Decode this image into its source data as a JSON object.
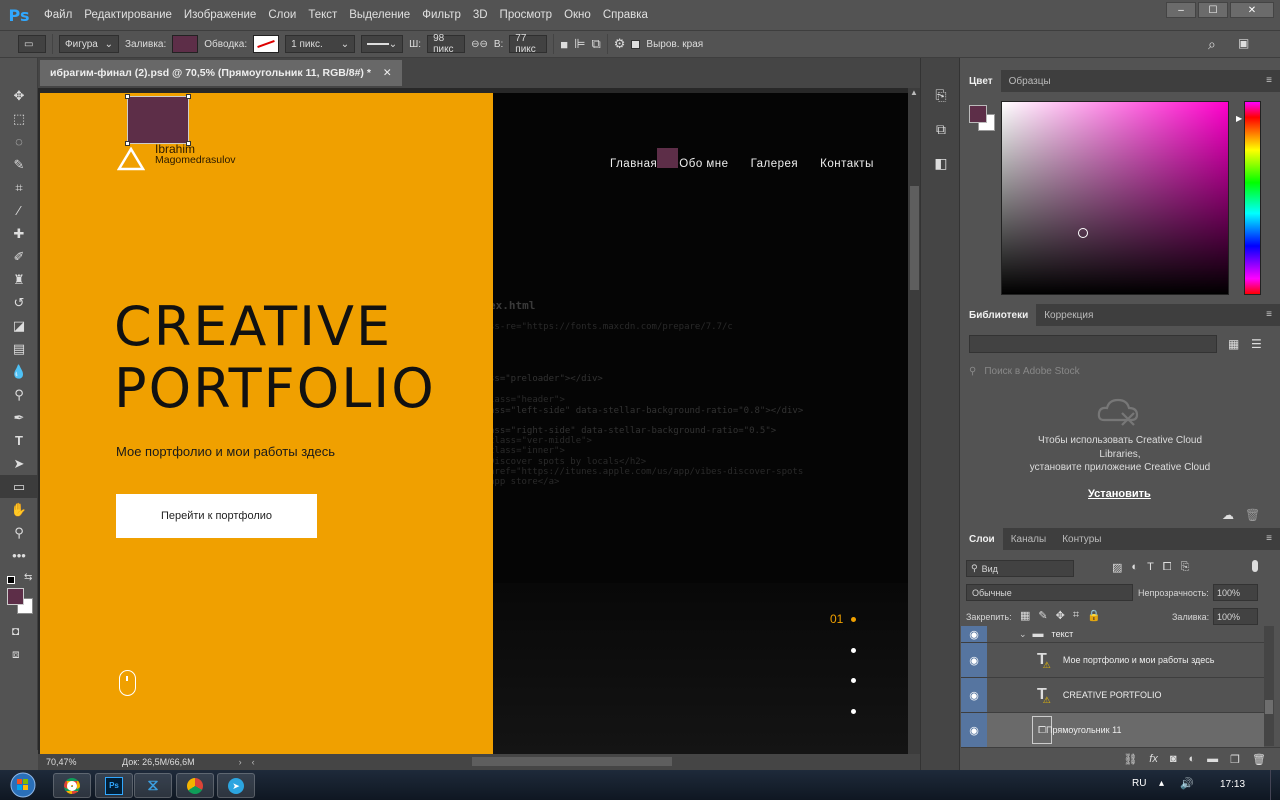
{
  "app": {
    "logo": "Ps"
  },
  "menu": [
    "Файл",
    "Редактирование",
    "Изображение",
    "Слои",
    "Текст",
    "Выделение",
    "Фильтр",
    "3D",
    "Просмотр",
    "Окно",
    "Справка"
  ],
  "options": {
    "tool_mode": "Фигура",
    "fill_label": "Заливка:",
    "stroke_label": "Обводка:",
    "stroke_size": "1 пикс.",
    "width_label": "Ш:",
    "width_value": "98 пикс",
    "height_label": "В:",
    "height_value": "77 пикс",
    "align_edges": "Выров. края",
    "fill_color": "#5d2e48"
  },
  "document": {
    "tab_title": "ибрагим-финал (2).psd @ 70,5% (Прямоугольник 11, RGB/8#) *",
    "zoom": "70,47%",
    "doc_size": "Док: 26,5M/66,6M"
  },
  "canvas": {
    "logo_first": "Ibrahim",
    "logo_last": "Magomedrasulov",
    "headline_1": "CREATIVE",
    "headline_2": "PORTFOLIO",
    "subline": "Мое портфолио и мои работы здесь",
    "cta": "Перейти к портфолио",
    "nav": [
      "Главная",
      "Обо мне",
      "Галерея",
      "Контакты"
    ],
    "slide_number": "01",
    "code_lines": [
      "ex.html",
      "ss-re=\"https://fonts.maxcdn.com/prepare/7.7/c",
      "ss=\"preloader\"></div>",
      "lass=\"header\">",
      "ass=\"left-side\" data-stellar-background-ratio=\"0.8\"></div>",
      "ass=\"right-side\" data-stellar-background-ratio=\"0.5\">",
      "class=\"ver-middle\">",
      "class=\"inner\">",
      "Discover spots by locals</h2>",
      "href=\"https://itunes.apple.com/us/app/vibes-discover-spots",
      "app store</a>"
    ],
    "accent": "#f0a000",
    "shape_color": "#5d2e48"
  },
  "color_panel": {
    "tabs": [
      "Цвет",
      "Образцы"
    ],
    "foreground": "#5d2e48",
    "background": "#ffffff"
  },
  "libraries_panel": {
    "tabs": [
      "Библиотеки",
      "Коррекция"
    ],
    "search_placeholder": "Поиск в Adobe Stock",
    "message_1": "Чтобы использовать Creative Cloud",
    "message_2": "Libraries,",
    "message_3": "установите приложение Creative Cloud",
    "install": "Установить"
  },
  "layers_panel": {
    "tabs": [
      "Слои",
      "Каналы",
      "Контуры"
    ],
    "filter": "Вид",
    "blend_mode": "Обычные",
    "opacity_label": "Непрозрачность:",
    "opacity_value": "100%",
    "lock_label": "Закрепить:",
    "fill_label": "Заливка:",
    "fill_value": "100%",
    "layers": [
      {
        "name": "текст",
        "kind": "group"
      },
      {
        "name": "Мое портфолио и мои работы здесь",
        "kind": "text"
      },
      {
        "name": "CREATIVE  PORTFOLIO",
        "kind": "text"
      },
      {
        "name": "Прямоугольник 11",
        "kind": "shape"
      }
    ]
  },
  "taskbar": {
    "lang": "RU",
    "time": "17:13"
  }
}
